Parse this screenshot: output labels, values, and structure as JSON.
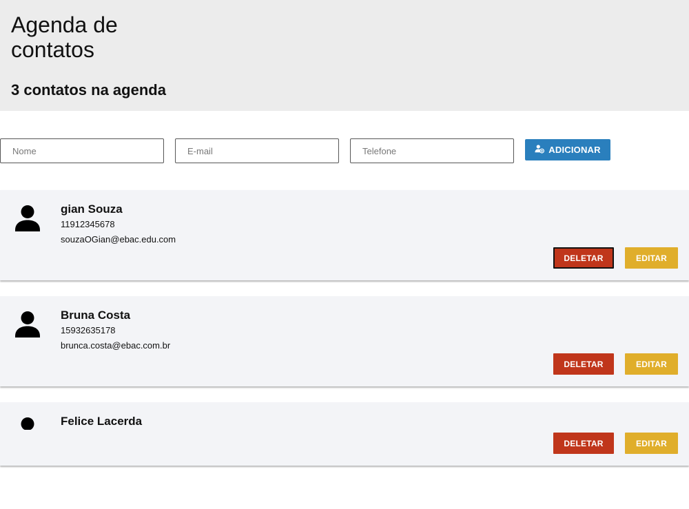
{
  "header": {
    "title": "Agenda de contatos",
    "count_label": "3 contatos na agenda"
  },
  "form": {
    "name_placeholder": "Nome",
    "email_placeholder": "E-mail",
    "phone_placeholder": "Telefone",
    "add_label": "ADICIONAR",
    "add_icon": "add-user-icon"
  },
  "contacts": [
    {
      "name": "gian Souza",
      "phone": "11912345678",
      "email": "souzaOGian@ebac.edu.com"
    },
    {
      "name": "Bruna Costa",
      "phone": "15932635178",
      "email": "brunca.costa@ebac.com.br"
    },
    {
      "name": "Felice Lacerda",
      "phone": "",
      "email": ""
    }
  ],
  "actions": {
    "delete_label": "DELETAR",
    "edit_label": "EDITAR"
  },
  "colors": {
    "header_bg": "#ececec",
    "card_bg": "#f3f4f7",
    "add_button": "#2a7fbd",
    "delete_button": "#c0361b",
    "edit_button": "#e0ae2b"
  }
}
